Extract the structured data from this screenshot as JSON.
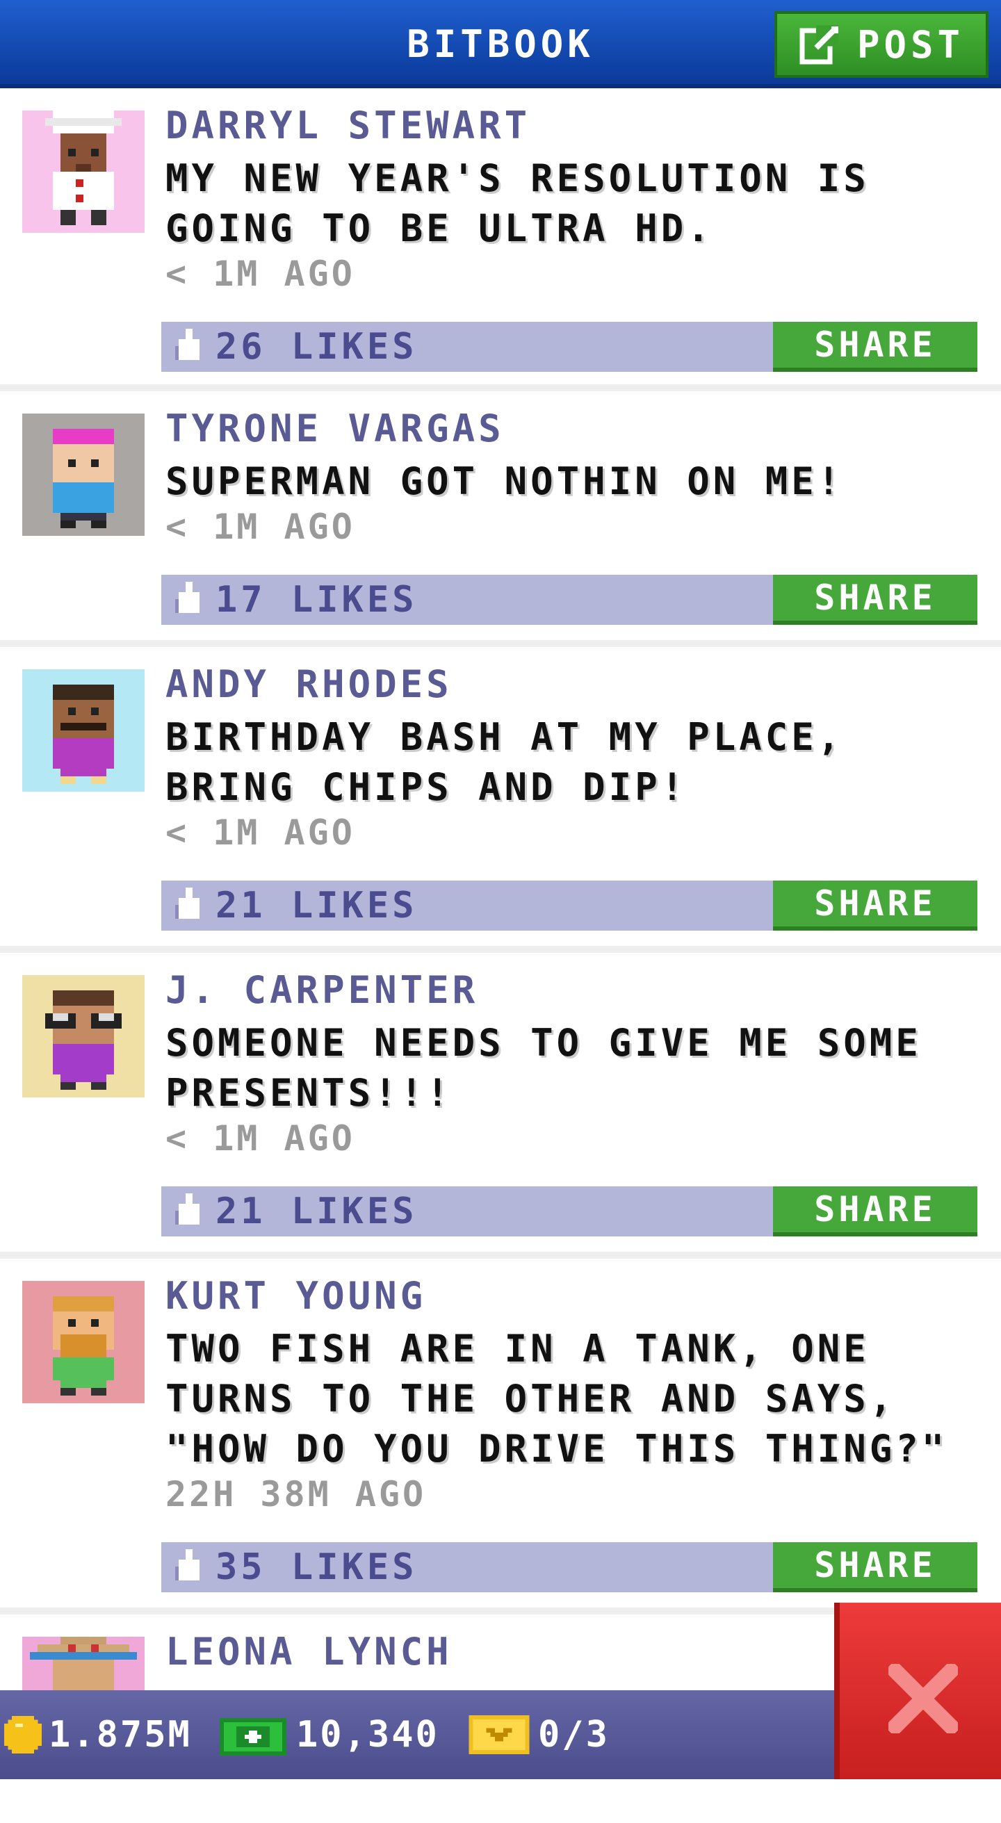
{
  "header": {
    "title": "BITBOOK",
    "post_label": "POST",
    "post_icon": "compose-icon"
  },
  "posts": [
    {
      "author": "DARRYL STEWART",
      "text": "MY NEW YEAR'S RESOLUTION IS GOING TO BE ULTRA HD.",
      "time": "< 1M AGO",
      "likes": "26 LIKES",
      "share": "SHARE",
      "avatar_bg": "#f8c4ec"
    },
    {
      "author": "TYRONE VARGAS",
      "text": "SUPERMAN GOT NOTHIN ON ME!",
      "time": "< 1M AGO",
      "likes": "17 LIKES",
      "share": "SHARE",
      "avatar_bg": "#aaa6a4"
    },
    {
      "author": "ANDY RHODES",
      "text": "BIRTHDAY BASH AT MY PLACE, BRING CHIPS AND DIP!",
      "time": "< 1M AGO",
      "likes": "21 LIKES",
      "share": "SHARE",
      "avatar_bg": "#b4e8f4"
    },
    {
      "author": "J. CARPENTER",
      "text": "SOMEONE NEEDS TO GIVE ME SOME PRESENTS!!!",
      "time": "< 1M AGO",
      "likes": "21 LIKES",
      "share": "SHARE",
      "avatar_bg": "#f0e0a6"
    },
    {
      "author": "KURT YOUNG",
      "text": "TWO FISH ARE IN A TANK, ONE TURNS TO THE OTHER AND SAYS, \"HOW DO YOU DRIVE THIS THING?\"",
      "time": "22H 38M AGO",
      "likes": "35 LIKES",
      "share": "SHARE",
      "avatar_bg": "#e89aa2"
    },
    {
      "author": "LEONA LYNCH",
      "avatar_bg": "#f0a8d8"
    }
  ],
  "status_bar": {
    "coins": "1.875M",
    "bux": "10,340",
    "tickets": "0/3"
  },
  "colors": {
    "header": "#1a4fb8",
    "likes_bar": "#b3b6d8",
    "share": "#46a83a",
    "close": "#dd2c2c"
  }
}
